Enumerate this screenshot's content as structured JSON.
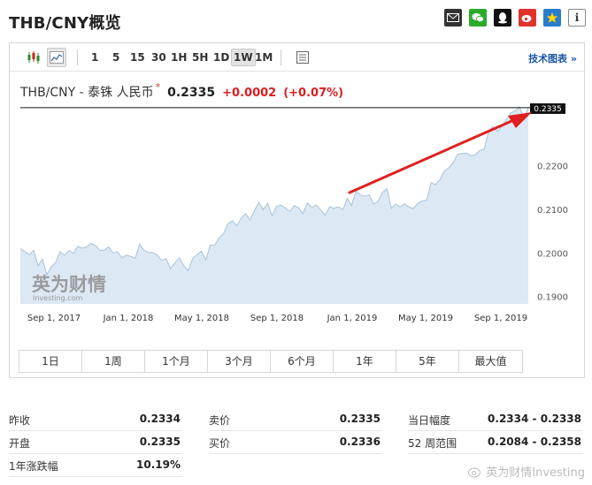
{
  "page": {
    "title": "THB/CNY概览"
  },
  "share": {
    "info_label": "i"
  },
  "toolbar": {
    "intervals": [
      "1",
      "5",
      "15",
      "30",
      "1H",
      "5H",
      "1D",
      "1W",
      "1M"
    ],
    "selected_interval": "1W",
    "tech_chart_link": "技术图表 »"
  },
  "quote": {
    "name": "THB/CNY - 泰铢 人民币",
    "star": "*",
    "price": "0.2335",
    "change": "+0.0002",
    "change_pct": "(+0.07%)",
    "change_color": "#d91e1e"
  },
  "chart_data": {
    "type": "area",
    "price_label": "0.2335",
    "y_ticks": [
      "0.2200",
      "0.2100",
      "0.2000",
      "0.1900"
    ],
    "ylim": [
      0.1885,
      0.2345
    ],
    "x_ticks": [
      "Sep 1, 2017",
      "Jan 1, 2018",
      "May 1, 2018",
      "Sep 1, 2018",
      "Jan 1, 2019",
      "May 1, 2019",
      "Sep 1, 2019"
    ],
    "logo_text": "英为财情",
    "logo_sub": "Investing.com",
    "fill_color": "#dce8f3",
    "line_color": "#a9c3db",
    "arrow_color": "#e02020",
    "values": [
      0.2012,
      0.2005,
      0.1998,
      0.2008,
      0.1972,
      0.1988,
      0.1952,
      0.197,
      0.198,
      0.2005,
      0.1996,
      0.2008,
      0.2001,
      0.2017,
      0.2013,
      0.2016,
      0.2024,
      0.2019,
      0.2008,
      0.2008,
      0.2016,
      0.2002,
      0.2005,
      0.1991,
      0.1997,
      0.1994,
      0.199,
      0.2022,
      0.2008,
      0.2003,
      0.2003,
      0.1997,
      0.1985,
      0.1989,
      0.1966,
      0.1979,
      0.1991,
      0.1973,
      0.1961,
      0.1989,
      0.1998,
      0.2006,
      0.1986,
      0.202,
      0.202,
      0.2036,
      0.2046,
      0.2069,
      0.2076,
      0.2064,
      0.2082,
      0.2092,
      0.2077,
      0.2099,
      0.2118,
      0.2101,
      0.2116,
      0.2087,
      0.2109,
      0.2112,
      0.2105,
      0.2097,
      0.2111,
      0.2105,
      0.2092,
      0.2117,
      0.2106,
      0.2112,
      0.2101,
      0.2088,
      0.2108,
      0.2104,
      0.2108,
      0.2101,
      0.2127,
      0.2111,
      0.2144,
      0.2135,
      0.2132,
      0.2135,
      0.2114,
      0.212,
      0.2141,
      0.2149,
      0.2104,
      0.2114,
      0.2107,
      0.2115,
      0.2107,
      0.2104,
      0.2116,
      0.2121,
      0.2123,
      0.2163,
      0.2159,
      0.217,
      0.219,
      0.2197,
      0.2209,
      0.2228,
      0.223,
      0.2231,
      0.2225,
      0.2227,
      0.2237,
      0.224,
      0.228,
      0.2292,
      0.2281,
      0.2292,
      0.2308,
      0.2323,
      0.2328,
      0.2337,
      0.2312,
      0.2335
    ]
  },
  "ranges": [
    "1日",
    "1周",
    "1个月",
    "3个月",
    "6个月",
    "1年",
    "5年",
    "最大值"
  ],
  "stats": {
    "col1": [
      {
        "label": "昨收",
        "value": "0.2334"
      },
      {
        "label": "开盘",
        "value": "0.2335"
      },
      {
        "label": "1年涨跌幅",
        "value": "10.19%"
      }
    ],
    "col2": [
      {
        "label": "卖价",
        "value": "0.2335"
      },
      {
        "label": "买价",
        "value": "0.2336"
      }
    ],
    "col3": [
      {
        "label": "当日幅度",
        "value": "0.2334 - 0.2338"
      },
      {
        "label": "52 周范围",
        "value": "0.2084 - 0.2358"
      }
    ]
  },
  "watermark": {
    "text": "英为财情Investing"
  }
}
